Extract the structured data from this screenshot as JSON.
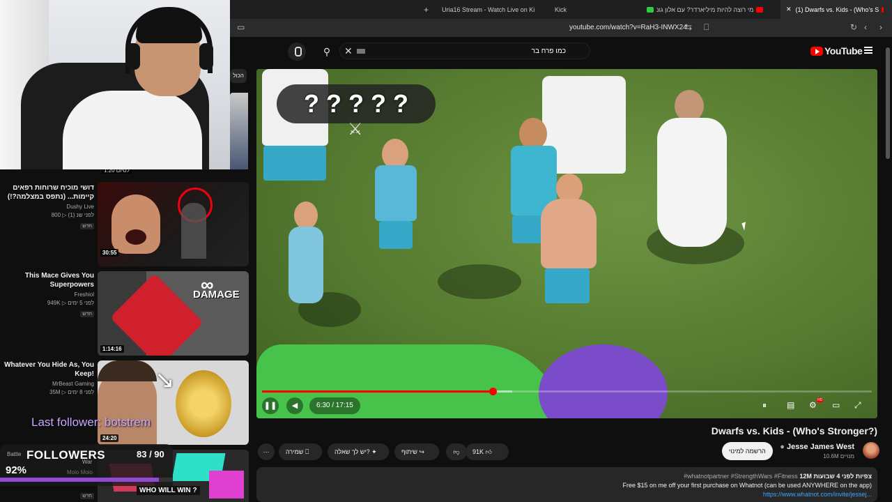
{
  "browser": {
    "tabs": [
      {
        "label": "(1) Dwarfs vs. Kids - (Who's S",
        "active": true
      },
      {
        "label": "מי רוצה להיות מיליארדר? עם אלון גונ"
      },
      {
        "label": "Kick"
      },
      {
        "label": "Uria16 Stream - Watch Live on Ki"
      }
    ],
    "new_tab": "+",
    "url": "youtube.com/watch?v=RaH3-INWX24"
  },
  "youtube": {
    "search_query": "כמו פרח בר",
    "logo_text": "YouTube",
    "chip_all": "הכול"
  },
  "overlay": {
    "followers_title": "FOLLOWERS",
    "followers_count": "83 / 90",
    "followers_percent": "92%",
    "followers_fraction": 0.92,
    "last_follower": "Last follower: botstrem",
    "small_label": "Battle",
    "small_label_2": "War",
    "small_label_3": "Moio Moio"
  },
  "recommendations": [
    {
      "title": "דושי מוכיח שרוחות רפאים קיימות... (נתפס במצלמה?!)",
      "channel": "Dushy Live",
      "stats": "800 ▷ לפני שנ (1)",
      "badge": "חדש",
      "duration": "30:55"
    },
    {
      "title": "This Mace Gives You Superpowers",
      "channel": "Freshiol",
      "stats": "949K ▷ לפני 5 ימים",
      "badge": "חדש",
      "duration": "1:14:16",
      "thumb_text": "DAMAGE"
    },
    {
      "title": "Whatever You Hide As, You Keep!",
      "channel": "MrBeast Gaming",
      "stats": "35M ▷ לפני 8 ימים",
      "badge": "",
      "duration": "24:20"
    },
    {
      "title": "",
      "channel": "",
      "stats": "",
      "badge": "חדש",
      "duration": "",
      "thumb_text": "WHO WILL WIN ?"
    }
  ],
  "top_partial_duration": "1:20 לסיום",
  "player": {
    "question_marks": [
      "?",
      "?",
      "?",
      "?",
      "?"
    ],
    "time": "6:30 / 17:15",
    "played_fraction": 0.378,
    "loaded_fraction": 0.41,
    "quality_badge": "HD"
  },
  "video": {
    "title": "Dwarfs vs. Kids - (Who's Stronger?)",
    "channel": "Jesse James West",
    "subscribers": "10.6M מנויים",
    "subscribe": "הרשמה למינוי",
    "likes": "91K",
    "share": "שיתוף",
    "ask": "יש לך שאלה?",
    "save": "שמירה",
    "more": "⋯",
    "desc_stats": "12M צפיות לפני 4 שבועות",
    "desc_tags": "#whatnotpartner #StrengthWars #Fitness",
    "desc_line2": "Free $15 on me off your first purchase on Whatnot (can be used ANYWHERE on the app)",
    "desc_link": "https://www.whatnot.com/invite/jessej..."
  },
  "colors": {
    "accent": "#ff0000",
    "follow_bar": "#8e4bd6",
    "link": "#3ea6ff"
  }
}
